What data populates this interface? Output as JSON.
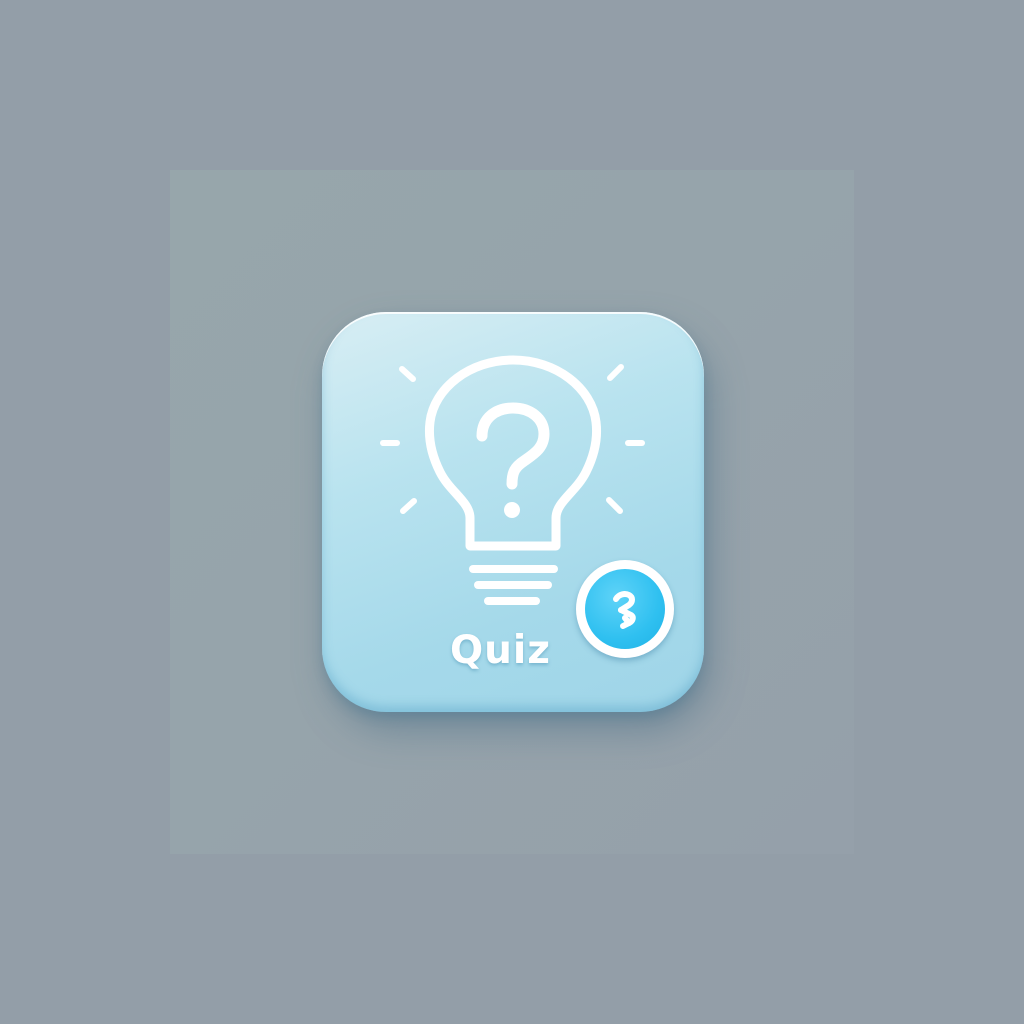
{
  "app_icon": {
    "label": "Quiz",
    "glyph": "lightbulb-question-icon",
    "badge_icon": "arrow-swap-icon",
    "colors": {
      "tile": "#a5d9ea",
      "badge": "#2fc0f0",
      "foreground": "#ffffff",
      "background": "#939ea8"
    }
  }
}
